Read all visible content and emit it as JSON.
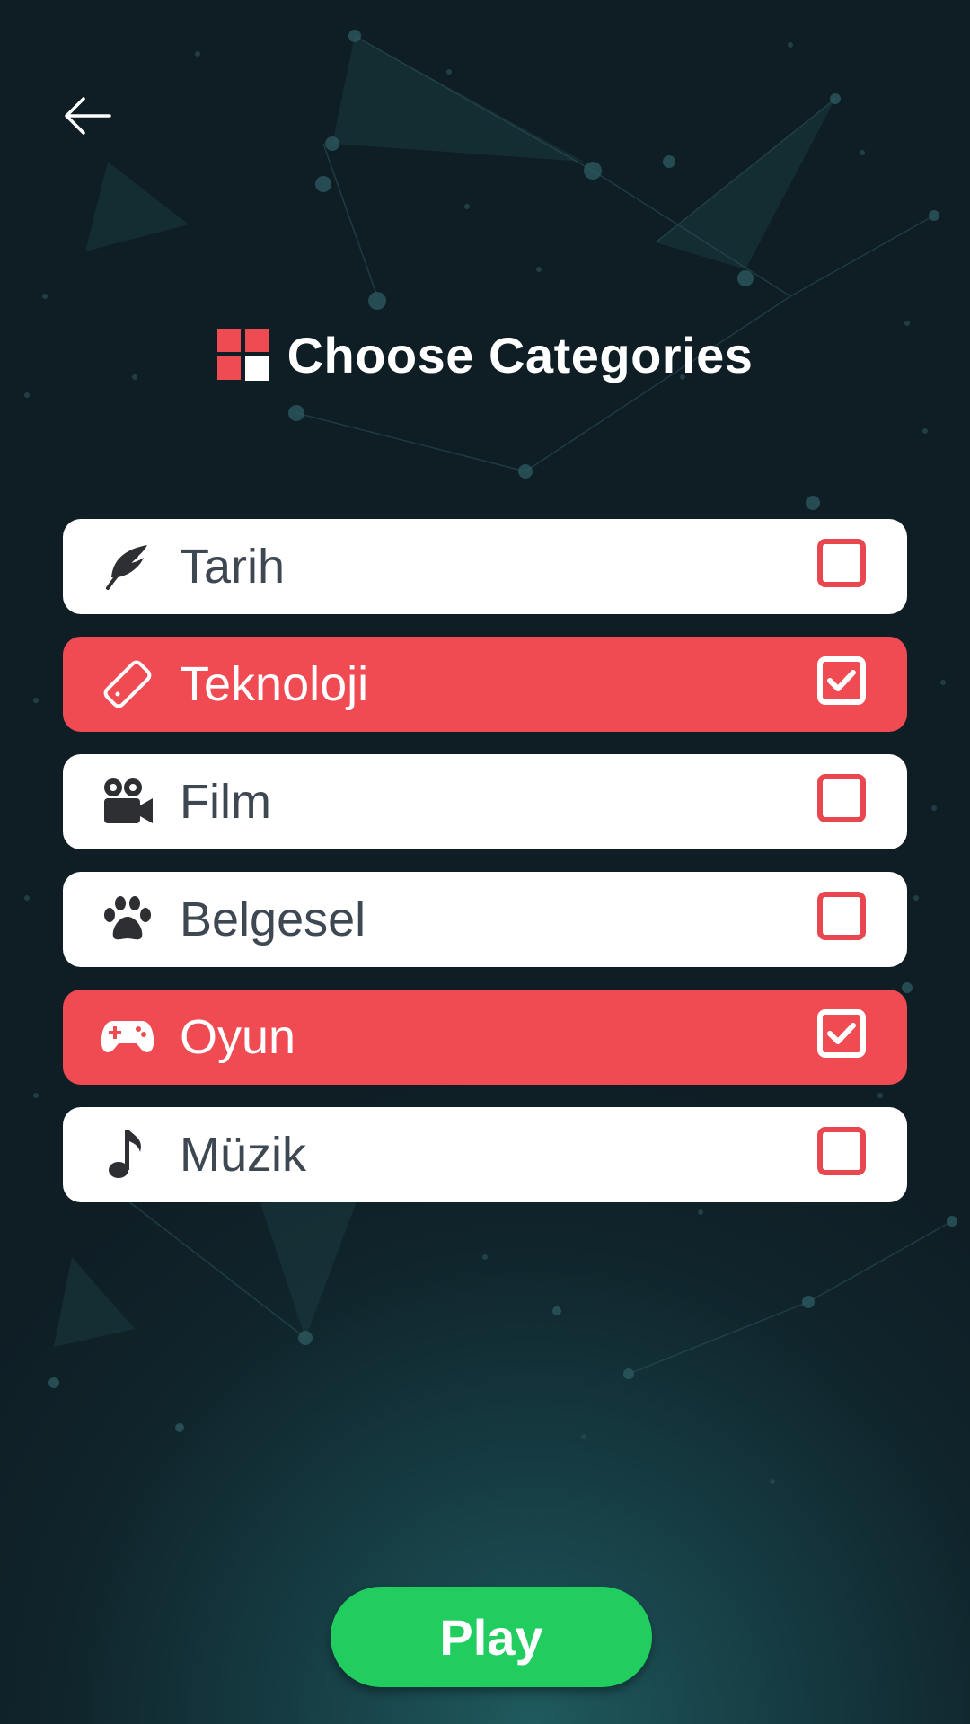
{
  "header": {
    "title": "Choose Categories"
  },
  "categories": [
    {
      "label": "Tarih",
      "icon": "leaf-icon",
      "checked": false
    },
    {
      "label": "Teknoloji",
      "icon": "phone-icon",
      "checked": true
    },
    {
      "label": "Film",
      "icon": "video-camera-icon",
      "checked": false
    },
    {
      "label": "Belgesel",
      "icon": "paw-icon",
      "checked": false
    },
    {
      "label": "Oyun",
      "icon": "gamepad-icon",
      "checked": true
    },
    {
      "label": "Müzik",
      "icon": "music-note-icon",
      "checked": false
    }
  ],
  "footer": {
    "play_label": "Play"
  },
  "colors": {
    "accent": "#f04b53",
    "play": "#22cd5f",
    "background": "#10242b",
    "text": "#3d4852"
  }
}
